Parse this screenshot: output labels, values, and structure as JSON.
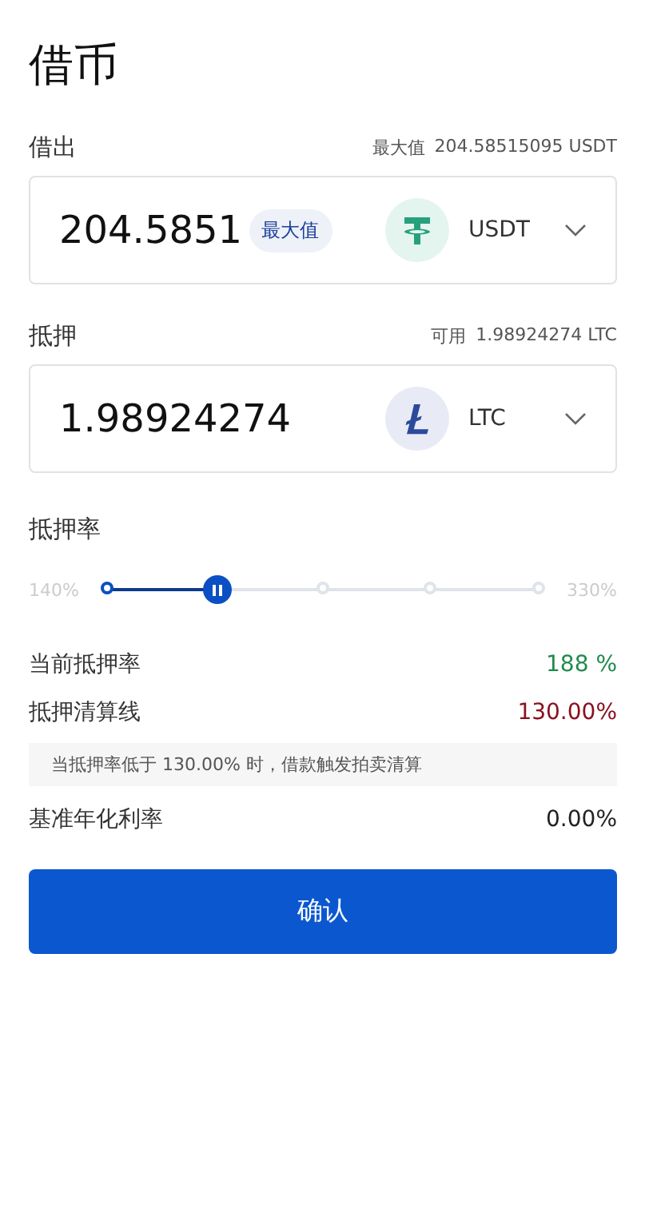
{
  "title": "借币",
  "borrow": {
    "label": "借出",
    "hint_label": "最大值",
    "hint_value": "204.58515095 USDT",
    "value": "204.5851",
    "max_button": "最大值",
    "coin": "USDT",
    "kind": "usdt"
  },
  "collateral": {
    "label": "抵押",
    "hint_label": "可用",
    "hint_value": "1.98924274 LTC",
    "value": "1.98924274",
    "coin": "LTC",
    "kind": "ltc"
  },
  "ratio": {
    "label": "抵押率",
    "min_label": "140%",
    "max_label": "330%",
    "level": 0.255
  },
  "info": [
    {
      "label": "当前抵押率",
      "value": "188 %",
      "color": "#1f8a4c"
    },
    {
      "label": "抵押清算线",
      "value": "130.00%",
      "color": "#8a1020"
    }
  ],
  "notice": "当抵押率低于 130.00% 时，借款触发拍卖清算",
  "rate": {
    "label": "基准年化利率",
    "value": "0.00%"
  },
  "confirm": "确认"
}
